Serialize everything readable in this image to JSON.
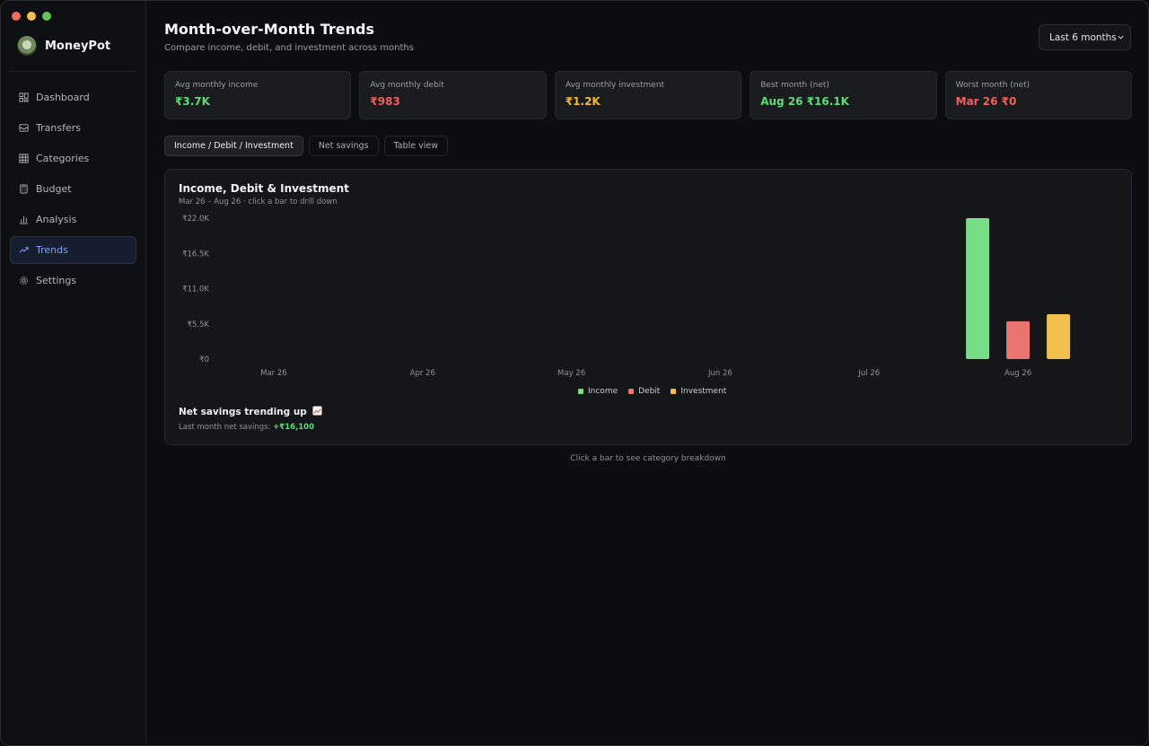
{
  "app": {
    "name": "MoneyPot",
    "logo": "moneypot-logo"
  },
  "nav": [
    {
      "label": "Dashboard",
      "icon": "grid-icon",
      "active": false
    },
    {
      "label": "Transfers",
      "icon": "inbox-icon",
      "active": false
    },
    {
      "label": "Categories",
      "icon": "table-icon",
      "active": false
    },
    {
      "label": "Budget",
      "icon": "calculator-icon",
      "active": false
    },
    {
      "label": "Analysis",
      "icon": "bar-chart-icon",
      "active": false
    },
    {
      "label": "Trends",
      "icon": "trend-up-icon",
      "active": true
    },
    {
      "label": "Settings",
      "icon": "gear-icon",
      "active": false
    }
  ],
  "header": {
    "title": "Month-over-Month Trends",
    "subtitle": "Compare income, debit, and investment across months",
    "range": "Last 6 months"
  },
  "stats": [
    {
      "label": "Avg monthly income",
      "value": "₹3.7K",
      "tone": "green"
    },
    {
      "label": "Avg monthly debit",
      "value": "₹983",
      "tone": "red"
    },
    {
      "label": "Avg monthly investment",
      "value": "₹1.2K",
      "tone": "amber"
    },
    {
      "label": "Best month (net)",
      "value": "Aug 26 ₹16.1K",
      "tone": "green"
    },
    {
      "label": "Worst month (net)",
      "value": "Mar 26 ₹0",
      "tone": "red"
    }
  ],
  "tabs": [
    {
      "label": "Income / Debit / Investment",
      "active": true
    },
    {
      "label": "Net savings",
      "active": false
    },
    {
      "label": "Table view",
      "active": false
    }
  ],
  "chart": {
    "title": "Income, Debit & Investment",
    "subtitle": "Mar 26 – Aug 26 · click a bar to drill down"
  },
  "chart_data": {
    "type": "bar",
    "categories": [
      "Mar 26",
      "Apr 26",
      "May 26",
      "Jun 26",
      "Jul 26",
      "Aug 26"
    ],
    "series": [
      {
        "name": "Income",
        "color": "#77dd87",
        "values": [
          0,
          0,
          0,
          0,
          0,
          22000
        ]
      },
      {
        "name": "Debit",
        "color": "#ea7470",
        "values": [
          0,
          0,
          0,
          0,
          0,
          5900
        ]
      },
      {
        "name": "Investment",
        "color": "#f1c04d",
        "values": [
          0,
          0,
          0,
          0,
          0,
          7000
        ]
      }
    ],
    "yticks": [
      "₹0",
      "₹5.5K",
      "₹11.0K",
      "₹16.5K",
      "₹22.0K"
    ],
    "ylim": [
      0,
      22000
    ],
    "grid": false,
    "legend": "bottom-center"
  },
  "trend": {
    "title": "Net savings trending up",
    "icon": "chart-up-icon",
    "label": "Last month net savings: ",
    "value": "+₹16,100"
  },
  "footer_hint": "Click a bar to see category breakdown"
}
